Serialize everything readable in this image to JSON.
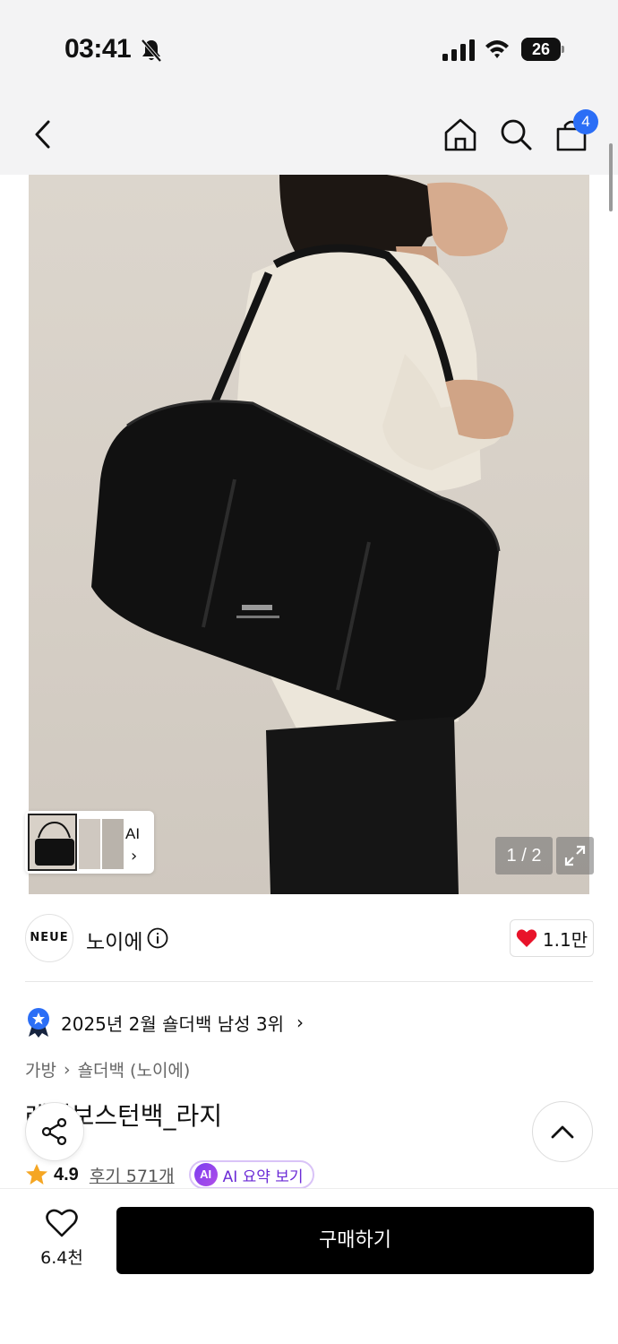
{
  "status_bar": {
    "time": "03:41",
    "battery_level": "26"
  },
  "nav": {
    "cart_count": "4"
  },
  "gallery": {
    "page_indicator": "1 / 2",
    "ai_label": "AI",
    "thumb_chevron": "›"
  },
  "brand": {
    "logo_text": "NEUE",
    "name": "노이에",
    "likes": "1.1만"
  },
  "ranking": {
    "text": "2025년 2월 숄더백 남성 3위",
    "chevron": "›"
  },
  "breadcrumb": {
    "category": "가방",
    "separator": "›",
    "subcategory": "숄더백 (노이에)"
  },
  "product": {
    "title": "레더보스턴백_라지"
  },
  "rating": {
    "score": "4.9",
    "reviews": "후기 571개",
    "ai_badge": "AI",
    "ai_summary": "AI 요약 보기"
  },
  "bottom_bar": {
    "wish_count": "6.4천",
    "buy_label": "구매하기"
  },
  "colors": {
    "accent_blue": "#2b6ef6",
    "heart_red": "#e8132a",
    "star_orange": "#f5a623",
    "ai_purple": "#7b3df0",
    "button_black": "#000000"
  }
}
